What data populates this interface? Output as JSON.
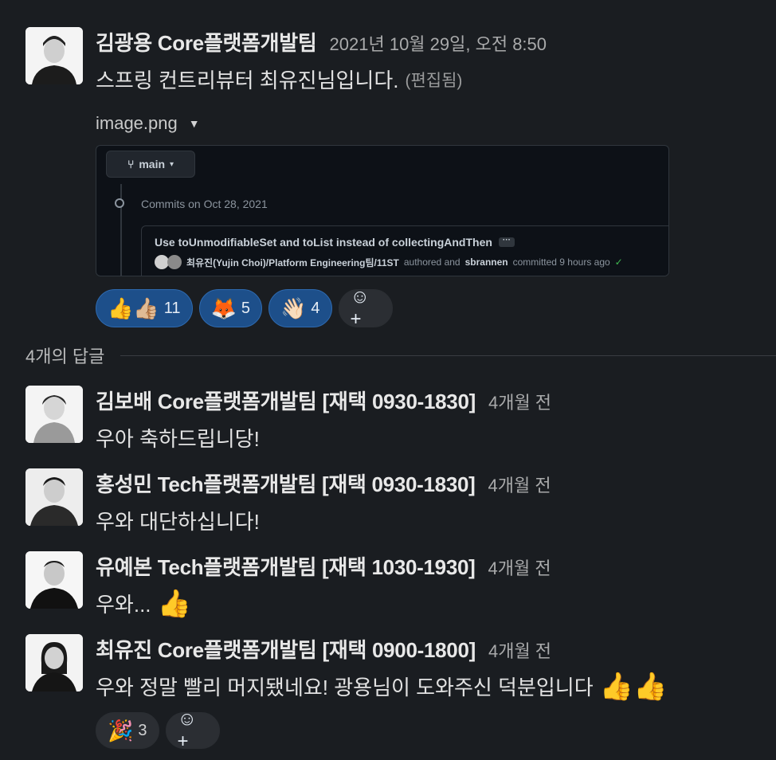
{
  "main_message": {
    "author": "김광용 Core플랫폼개발팀",
    "timestamp": "2021년 10월 29일, 오전 8:50",
    "text": "스프링 컨트리뷰터 최유진님입니다.",
    "edited": "(편집됨)",
    "attachment": {
      "filename": "image.png",
      "caret_icon": "▼",
      "preview": {
        "branch": "main",
        "commits_on": "Commits on Oct 28, 2021",
        "commit_title": "Use toUnmodifiableSet and toList instead of collectingAndThen",
        "ellipsis": "···",
        "commit_author": "최유진(Yujin Choi)/Platform Engineering팀/11ST",
        "authored_and": "authored and",
        "committer": "sbrannen",
        "committed_time": "committed 9 hours ago",
        "check_icon": "✓"
      }
    },
    "reactions": [
      {
        "emoji": "👍👍🏼",
        "count": "11",
        "active": true
      },
      {
        "emoji": "🦊",
        "count": "5",
        "active": true
      },
      {
        "emoji": "👋🏻",
        "count": "4",
        "active": true
      }
    ],
    "add_reaction_icon": "☺+"
  },
  "replies_label": "4개의 답글",
  "replies": [
    {
      "author": "김보배 Core플랫폼개발팀 [재택 0930-1830]",
      "time": "4개월 전",
      "text": "우아 축하드립니당!"
    },
    {
      "author": "홍성민 Tech플랫폼개발팀 [재택 0930-1830]",
      "time": "4개월 전",
      "text": "우와 대단하십니다!"
    },
    {
      "author": "유예본 Tech플랫폼개발팀 [재택 1030-1930]",
      "time": "4개월 전",
      "text": "우와...",
      "emoji": "👍"
    },
    {
      "author": "최유진 Core플랫폼개발팀 [재택 0900-1800]",
      "time": "4개월 전",
      "text": "우와 정말 빨리 머지됐네요! 광용님이 도와주신 덕분입니다",
      "emoji": "👍👍",
      "reactions": [
        {
          "emoji": "🎉",
          "count": "3"
        }
      ]
    }
  ],
  "colors": {
    "background": "#1a1d21",
    "reaction_active": "#1d4f8a",
    "reaction_border": "#2e6ab0"
  }
}
